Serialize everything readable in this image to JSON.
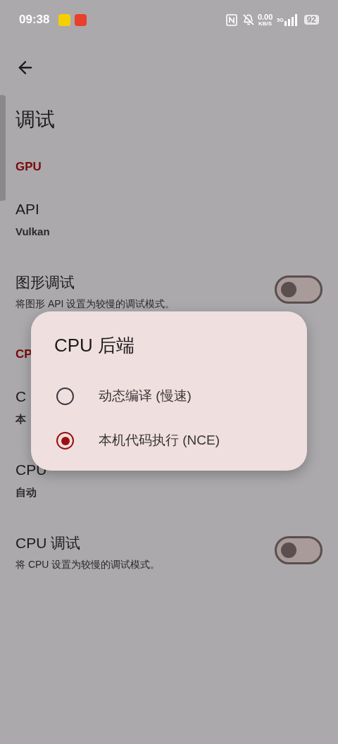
{
  "status_bar": {
    "time": "09:38",
    "network_speed": "0.00",
    "network_speed_unit": "KB/S",
    "network_type": "5G",
    "battery": "92"
  },
  "header": {
    "title": "调试"
  },
  "sections": [
    {
      "header": "GPU",
      "items": [
        {
          "kind": "value",
          "title": "API",
          "value": "Vulkan"
        },
        {
          "kind": "switch",
          "title": "图形调试",
          "description": "将图形 API 设置为较慢的调试模式。",
          "on": false
        }
      ]
    },
    {
      "header": "CP",
      "items": [
        {
          "kind": "value",
          "title": "C",
          "value": "本"
        },
        {
          "kind": "value",
          "title": "CPU",
          "value": "自动"
        },
        {
          "kind": "switch",
          "title": "CPU 调试",
          "description": "将 CPU 设置为较慢的调试模式。",
          "on": false
        }
      ]
    }
  ],
  "dialog": {
    "title": "CPU 后端",
    "options": [
      {
        "label": "动态编译 (慢速)",
        "selected": false
      },
      {
        "label": "本机代码执行 (NCE)",
        "selected": true
      }
    ]
  }
}
